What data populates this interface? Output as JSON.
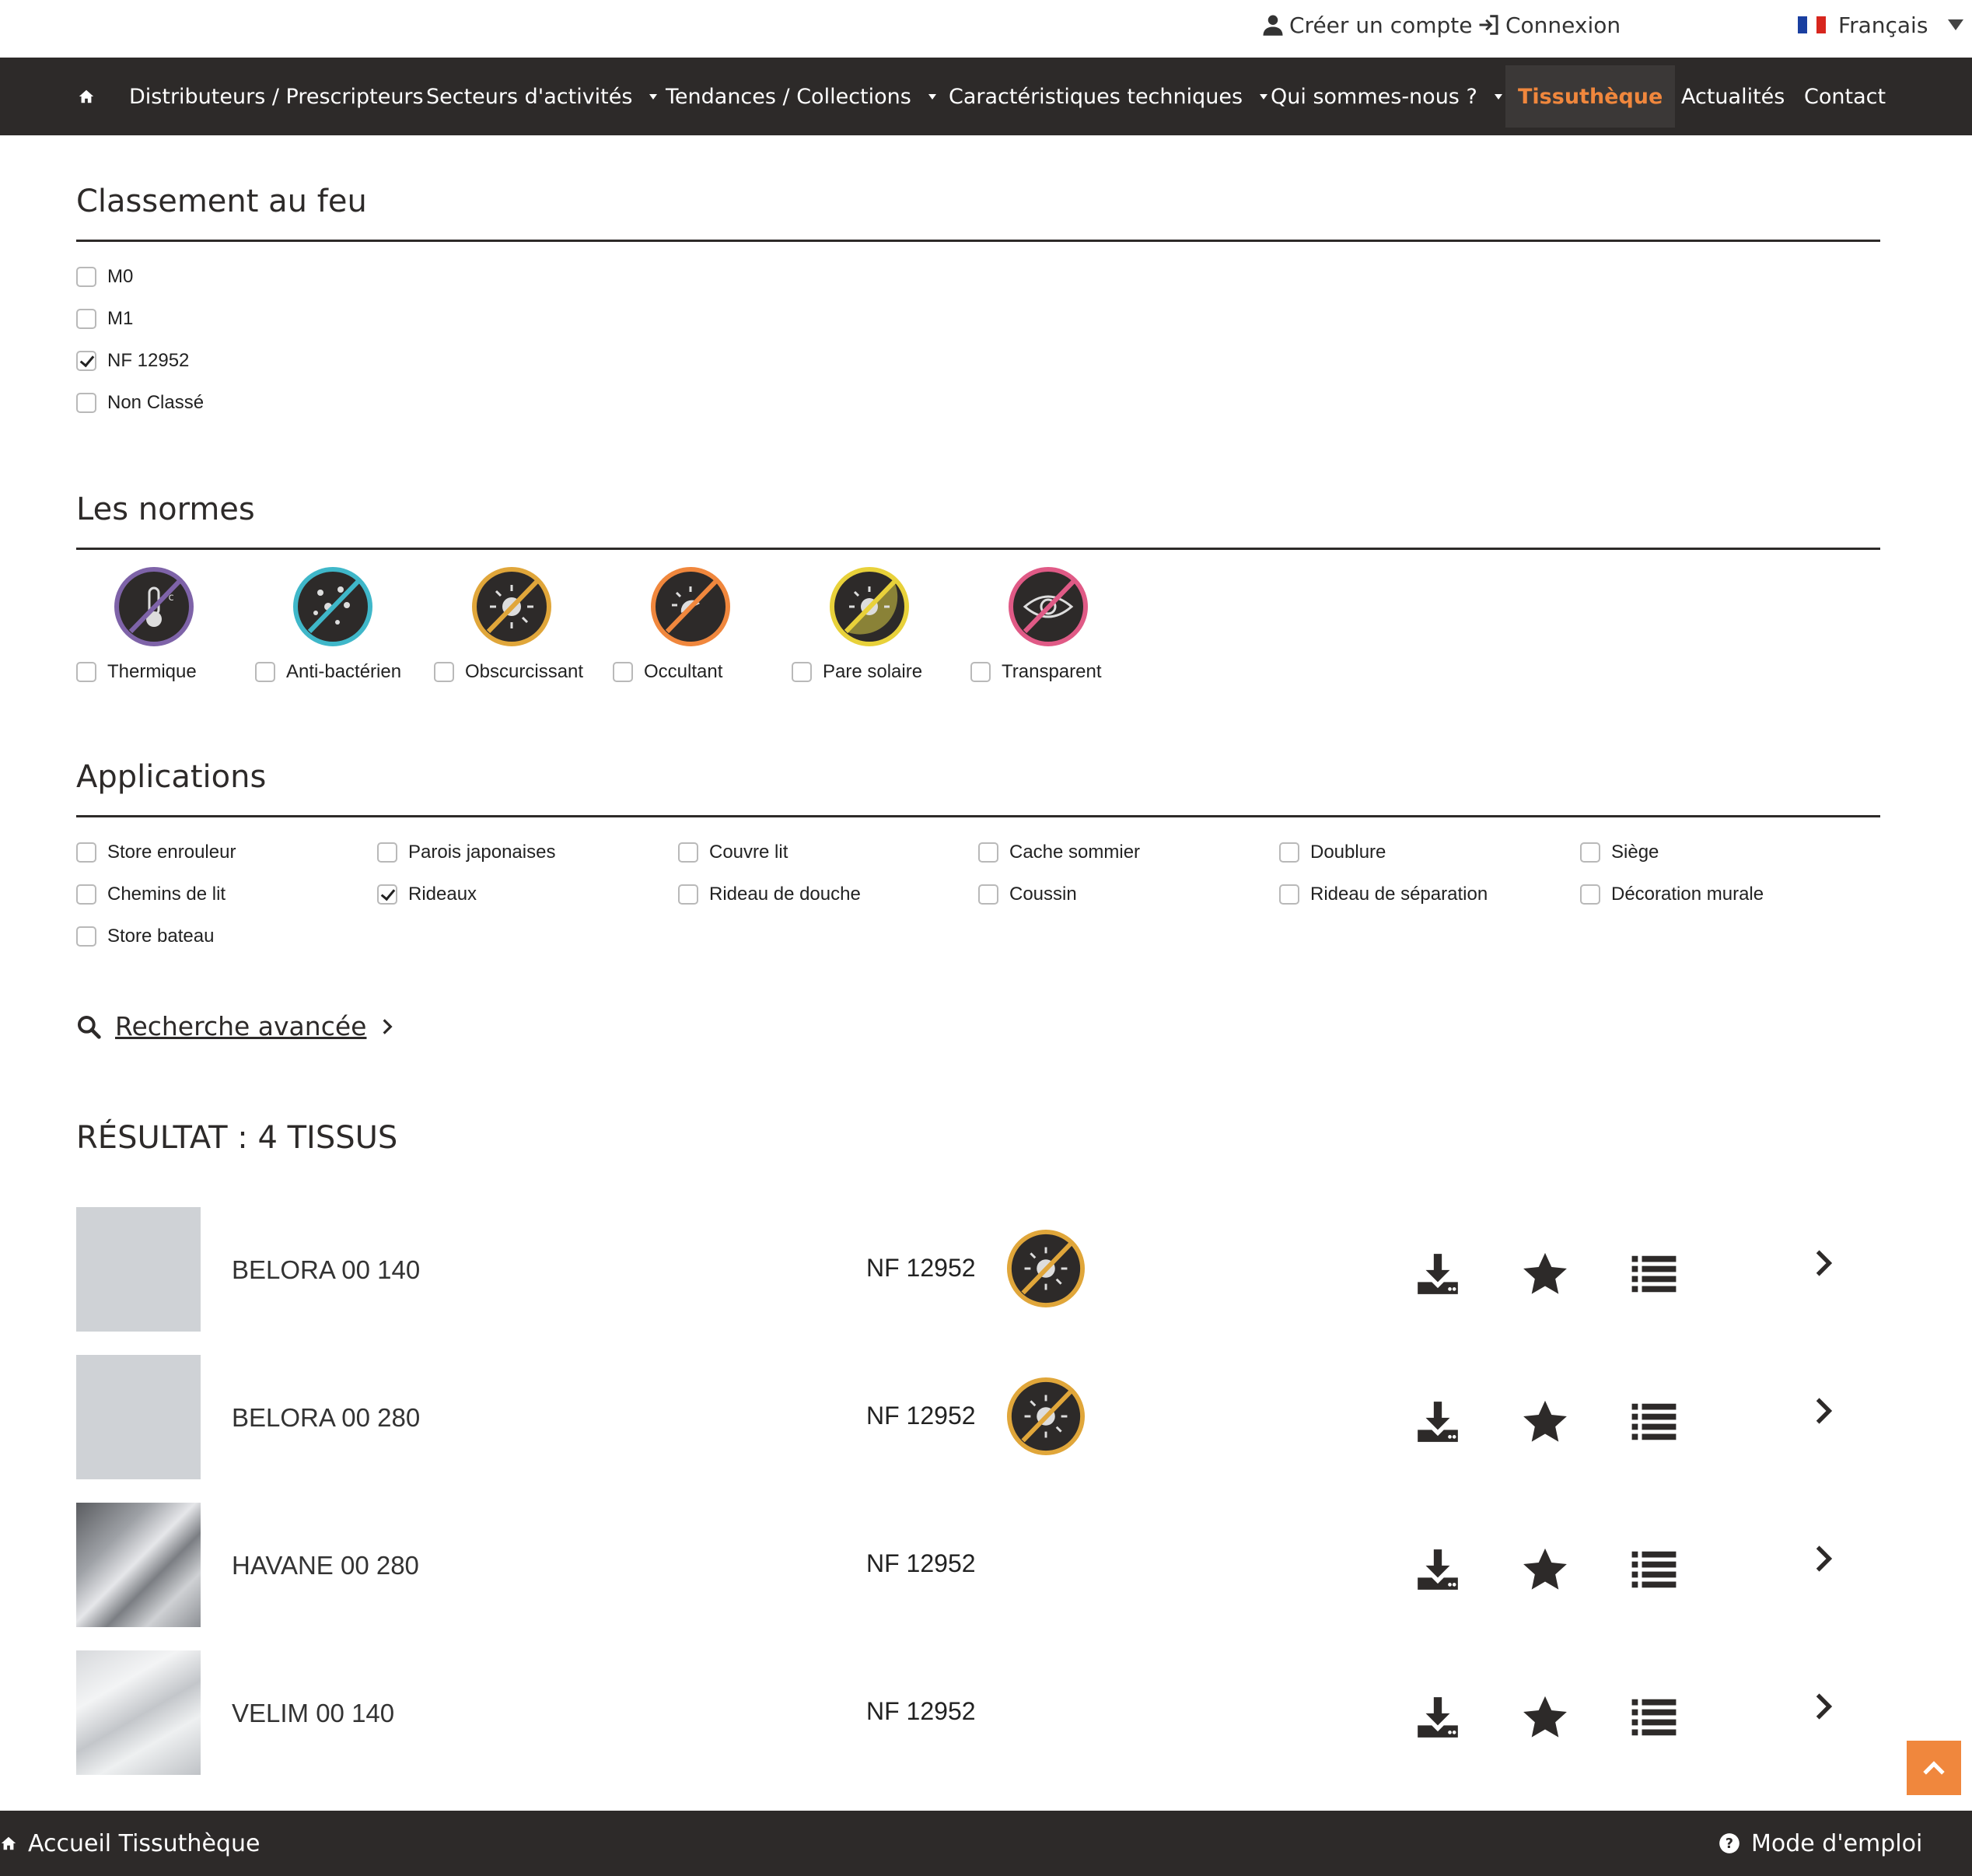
{
  "topbar": {
    "create_account": "Créer un compte",
    "login": "Connexion",
    "language": "Français",
    "flag_colors": [
      "#1a3fa0",
      "#ffffff",
      "#d7261e"
    ]
  },
  "nav": {
    "home_icon": "home-icon",
    "items": [
      {
        "label": "Distributeurs / Prescripteurs",
        "dropdown": false
      },
      {
        "label": "Secteurs d'activités",
        "dropdown": true
      },
      {
        "label": "Tendances / Collections",
        "dropdown": true
      },
      {
        "label": "Caractéristiques techniques",
        "dropdown": true
      },
      {
        "label": "Qui sommes-nous ?",
        "dropdown": true
      },
      {
        "label": "Tissuthèque",
        "dropdown": false,
        "active": true
      },
      {
        "label": "Actualités",
        "dropdown": false
      },
      {
        "label": "Contact",
        "dropdown": false
      }
    ],
    "accent_color": "#f0873d"
  },
  "fire": {
    "title": "Classement au feu",
    "options": [
      {
        "label": "M0",
        "checked": false
      },
      {
        "label": "M1",
        "checked": false
      },
      {
        "label": "NF 12952",
        "checked": true
      },
      {
        "label": "Non Classé",
        "checked": false
      }
    ]
  },
  "norms": {
    "title": "Les normes",
    "options": [
      {
        "label": "Thermique",
        "icon": "thermometer-icon",
        "ring": "#7e63a8",
        "checked": false
      },
      {
        "label": "Anti-bactérien",
        "icon": "bacteria-icon",
        "ring": "#3fb7c9",
        "checked": false
      },
      {
        "label": "Obscurcissant",
        "icon": "sun-dim-icon",
        "ring": "#e0a63a",
        "checked": false
      },
      {
        "label": "Occultant",
        "icon": "sun-block-icon",
        "ring": "#f0873d",
        "checked": false
      },
      {
        "label": "Pare solaire",
        "icon": "sun-shade-icon",
        "ring": "#e8d13a",
        "checked": false
      },
      {
        "label": "Transparent",
        "icon": "eye-icon",
        "ring": "#e05a86",
        "checked": false
      }
    ]
  },
  "applications": {
    "title": "Applications",
    "options": [
      {
        "label": "Store enrouleur",
        "checked": false
      },
      {
        "label": "Parois japonaises",
        "checked": false
      },
      {
        "label": "Couvre lit",
        "checked": false
      },
      {
        "label": "Cache sommier",
        "checked": false
      },
      {
        "label": "Doublure",
        "checked": false
      },
      {
        "label": "Siège",
        "checked": false
      },
      {
        "label": "Chemins de lit",
        "checked": false
      },
      {
        "label": "Rideaux",
        "checked": true
      },
      {
        "label": "Rideau de douche",
        "checked": false
      },
      {
        "label": "Coussin",
        "checked": false
      },
      {
        "label": "Rideau de séparation",
        "checked": false
      },
      {
        "label": "Décoration murale",
        "checked": false
      },
      {
        "label": "Store bateau",
        "checked": false
      }
    ]
  },
  "advanced_search": "Recherche avancée",
  "results": {
    "title": "RÉSULTAT : 4 TISSUS",
    "items": [
      {
        "name": "BELORA 00 140",
        "norm": "NF 12952",
        "norm_icon": "sun-dim-icon",
        "swatch": "plain"
      },
      {
        "name": "BELORA 00 280",
        "norm": "NF 12952",
        "norm_icon": "sun-dim-icon",
        "swatch": "plain"
      },
      {
        "name": "HAVANE 00 280",
        "norm": "NF 12952",
        "norm_icon": null,
        "swatch": "draped-dark"
      },
      {
        "name": "VELIM 00 140",
        "norm": "NF 12952",
        "norm_icon": null,
        "swatch": "draped-light"
      }
    ],
    "actions": [
      "download-icon",
      "star-icon",
      "list-icon",
      "chevron-right-icon"
    ]
  },
  "footer": {
    "home": "Accueil Tissuthèque",
    "help": "Mode d'emploi"
  }
}
